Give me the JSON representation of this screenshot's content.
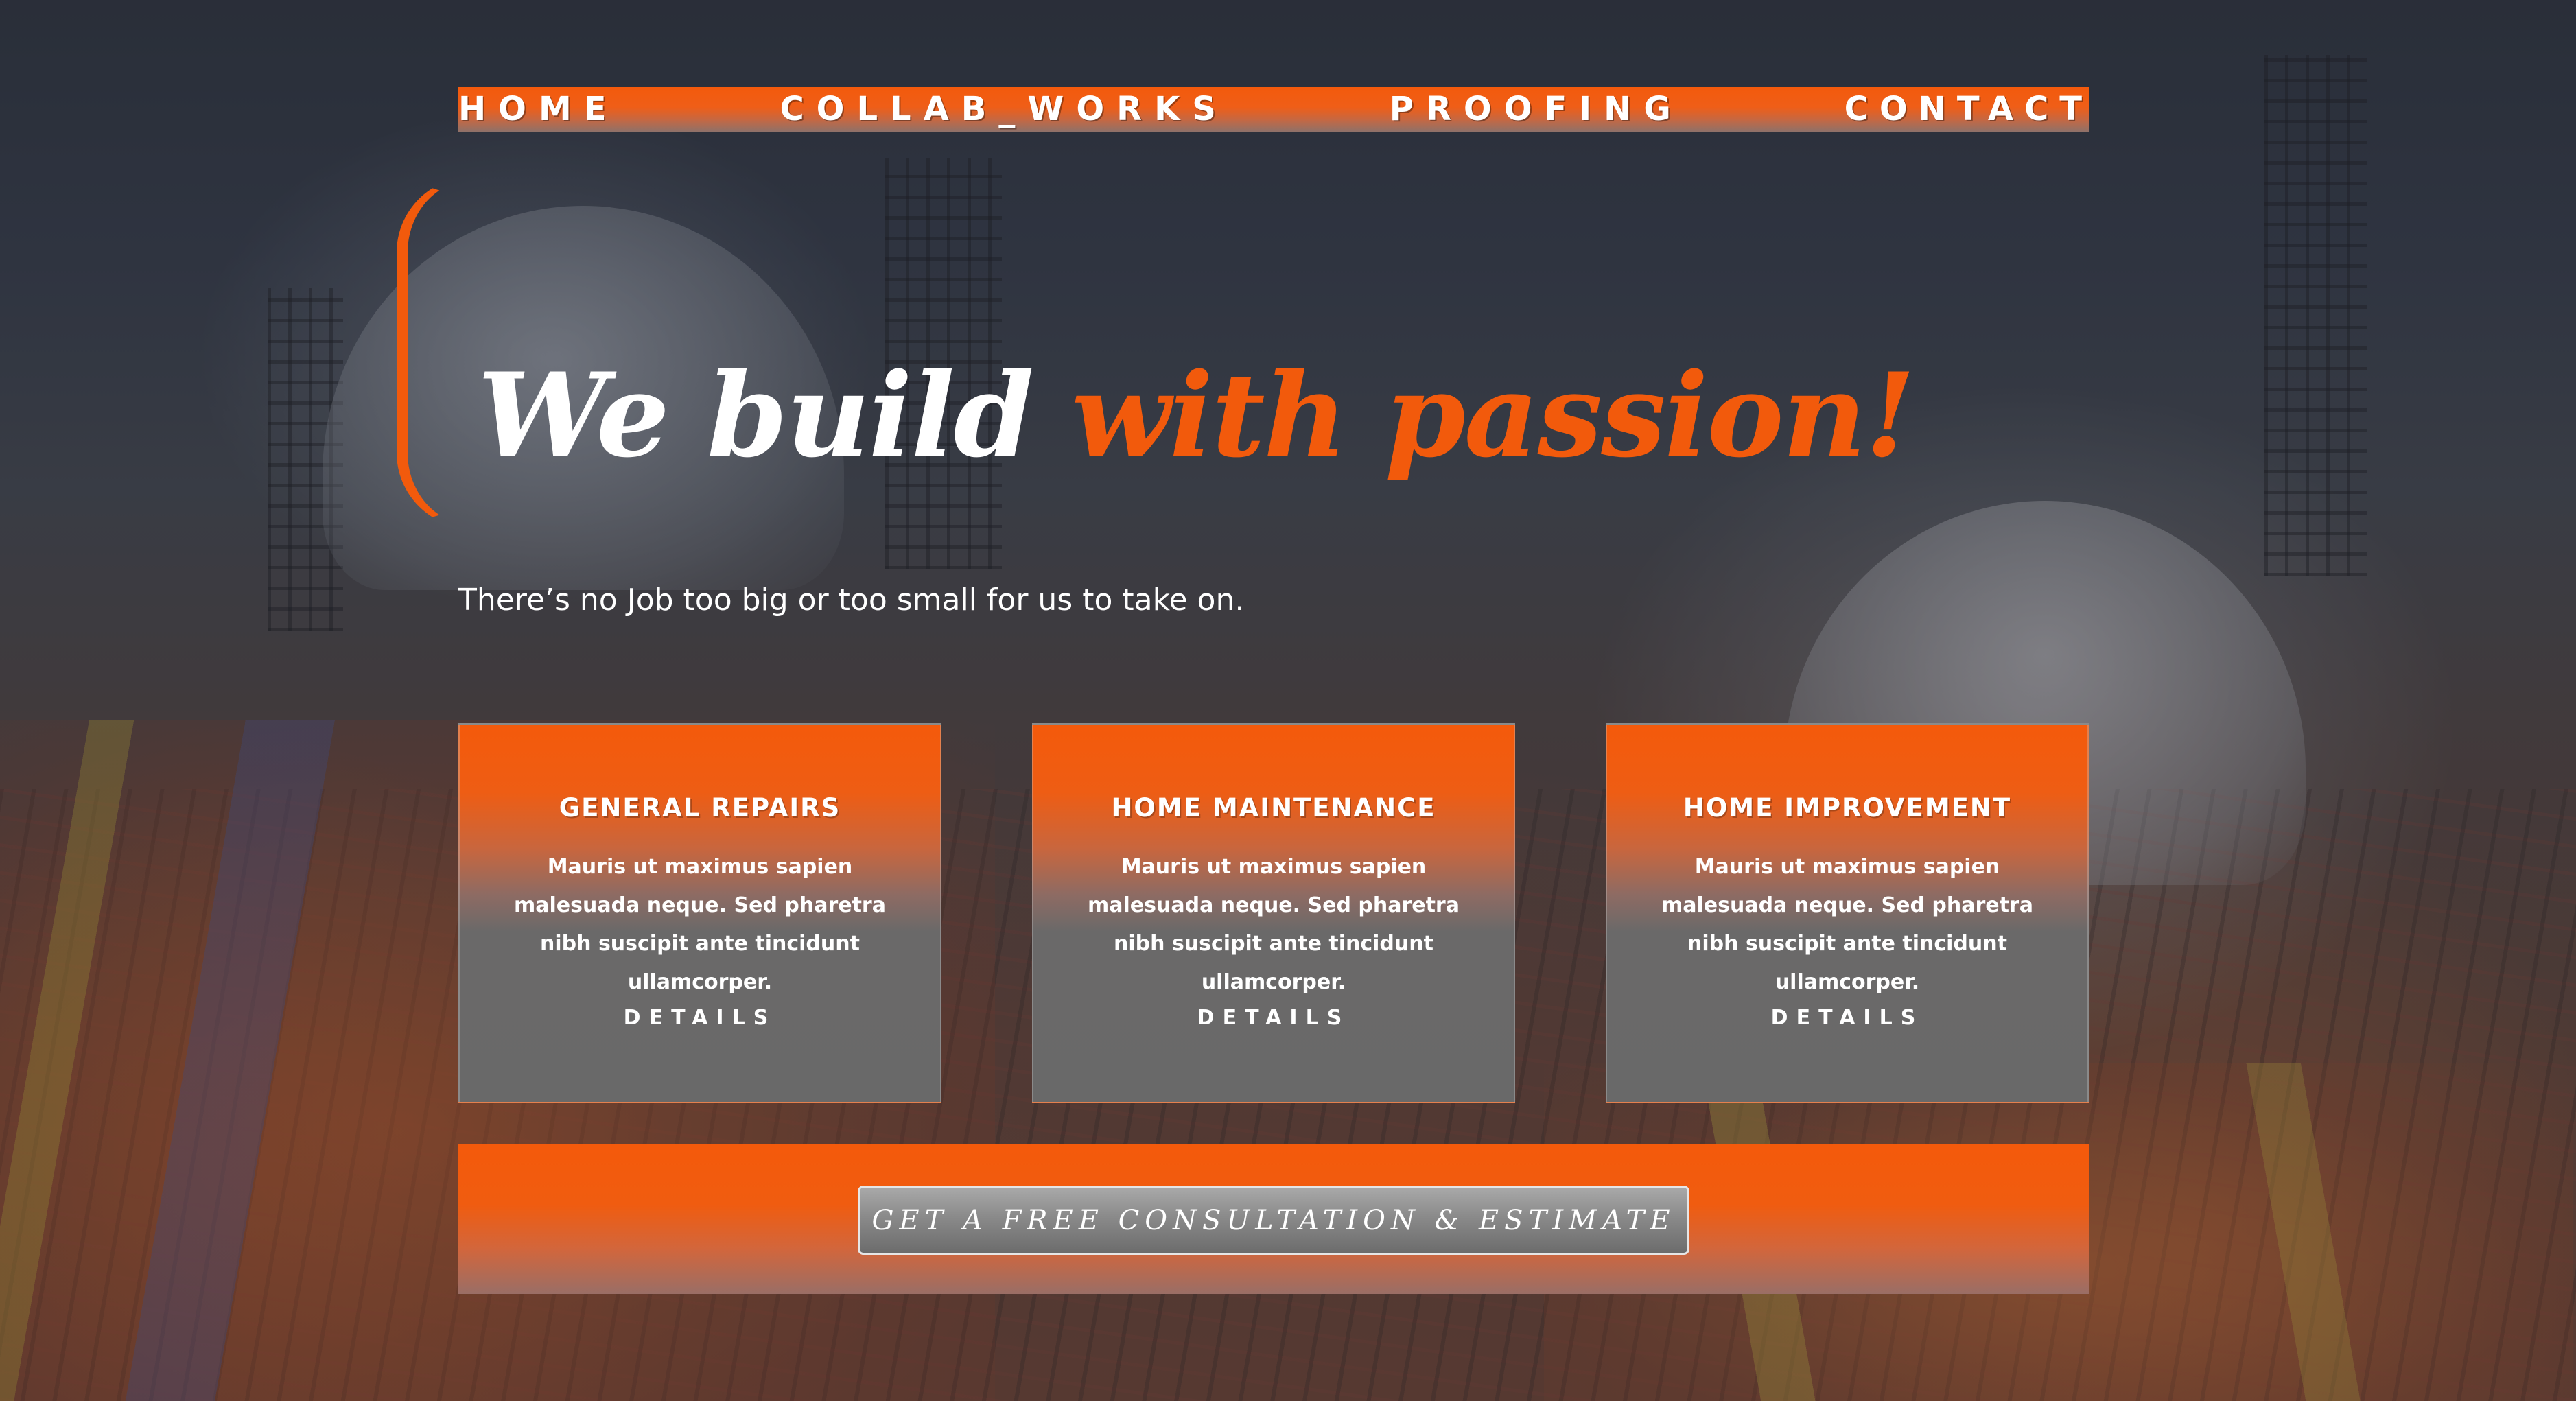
{
  "nav": {
    "items": [
      {
        "label": "HOME"
      },
      {
        "label": "COLLAB_WORKS"
      },
      {
        "label": "PROOFING"
      },
      {
        "label": "CONTACT"
      }
    ]
  },
  "hero": {
    "title_white": "We build",
    "title_orange": "with passion!",
    "subtitle": "There’s no Job too big or too small for us to take on."
  },
  "cards": [
    {
      "title": "GENERAL REPAIRS",
      "text": "Mauris ut maximus sapien malesuada neque. Sed pharetra nibh suscipit ante tincidunt ullamcorper.",
      "link": "DETAILS"
    },
    {
      "title": "HOME MAINTENANCE",
      "text": "Mauris ut maximus sapien malesuada neque. Sed pharetra nibh suscipit ante tincidunt ullamcorper.",
      "link": "DETAILS"
    },
    {
      "title": "HOME IMPROVEMENT",
      "text": "Mauris ut maximus sapien malesuada neque. Sed pharetra nibh suscipit ante tincidunt ullamcorper.",
      "link": "DETAILS"
    }
  ],
  "cta": {
    "button_label": "GET A FREE CONSULTATION & ESTIMATE"
  },
  "colors": {
    "accent": "#f25a0c",
    "card_bottom": "#696969",
    "text": "#ffffff"
  },
  "background": {
    "icon": "construction-site-photo"
  }
}
